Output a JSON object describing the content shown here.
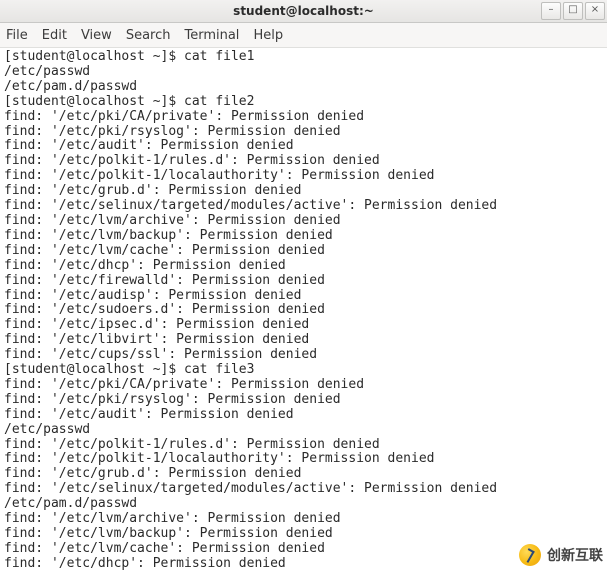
{
  "window": {
    "title": "student@localhost:~",
    "controls": {
      "min": "–",
      "max": "□",
      "close": "×"
    }
  },
  "menu": {
    "file": "File",
    "edit": "Edit",
    "view": "View",
    "search": "Search",
    "terminal": "Terminal",
    "help": "Help"
  },
  "prompt": {
    "user_host": "[student@localhost ~]$ ",
    "cmd1": "cat file1",
    "cmd2": "cat file2",
    "cmd3": "cat file3"
  },
  "file1_output": [
    "/etc/passwd",
    "/etc/pam.d/passwd"
  ],
  "file2_output": [
    "find: '/etc/pki/CA/private': Permission denied",
    "find: '/etc/pki/rsyslog': Permission denied",
    "find: '/etc/audit': Permission denied",
    "find: '/etc/polkit-1/rules.d': Permission denied",
    "find: '/etc/polkit-1/localauthority': Permission denied",
    "find: '/etc/grub.d': Permission denied",
    "find: '/etc/selinux/targeted/modules/active': Permission denied",
    "find: '/etc/lvm/archive': Permission denied",
    "find: '/etc/lvm/backup': Permission denied",
    "find: '/etc/lvm/cache': Permission denied",
    "find: '/etc/dhcp': Permission denied",
    "find: '/etc/firewalld': Permission denied",
    "find: '/etc/audisp': Permission denied",
    "find: '/etc/sudoers.d': Permission denied",
    "find: '/etc/ipsec.d': Permission denied",
    "find: '/etc/libvirt': Permission denied",
    "find: '/etc/cups/ssl': Permission denied"
  ],
  "file3_output": [
    "find: '/etc/pki/CA/private': Permission denied",
    "find: '/etc/pki/rsyslog': Permission denied",
    "find: '/etc/audit': Permission denied",
    "/etc/passwd",
    "find: '/etc/polkit-1/rules.d': Permission denied",
    "find: '/etc/polkit-1/localauthority': Permission denied",
    "find: '/etc/grub.d': Permission denied",
    "find: '/etc/selinux/targeted/modules/active': Permission denied",
    "/etc/pam.d/passwd",
    "find: '/etc/lvm/archive': Permission denied",
    "find: '/etc/lvm/backup': Permission denied",
    "find: '/etc/lvm/cache': Permission denied",
    "find: '/etc/dhcp': Permission denied"
  ],
  "watermark": {
    "text": "创新互联"
  }
}
